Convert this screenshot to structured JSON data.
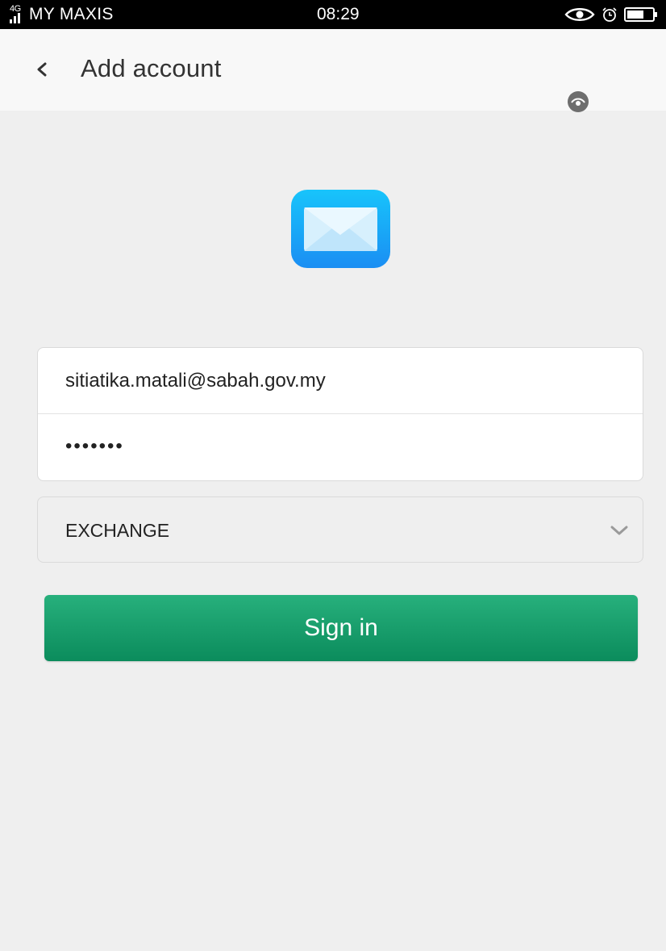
{
  "status_bar": {
    "network": "4G",
    "carrier": "MY MAXIS",
    "time": "08:29",
    "icons": [
      "signal-icon",
      "eye-icon",
      "alarm-icon",
      "battery-icon"
    ]
  },
  "header": {
    "back_icon": "chevron-left-icon",
    "title": "Add account"
  },
  "app_icon": "mail-icon",
  "form": {
    "email": "sitiatika.matali@sabah.gov.my",
    "password_masked": "•••••••",
    "password_toggle_icon": "eye-icon",
    "account_type": "EXCHANGE",
    "account_type_icon": "chevron-down-icon",
    "signin_label": "Sign in"
  },
  "colors": {
    "accent": "#0f9466",
    "mail_icon": "#1aa8f5",
    "background": "#efefef"
  }
}
